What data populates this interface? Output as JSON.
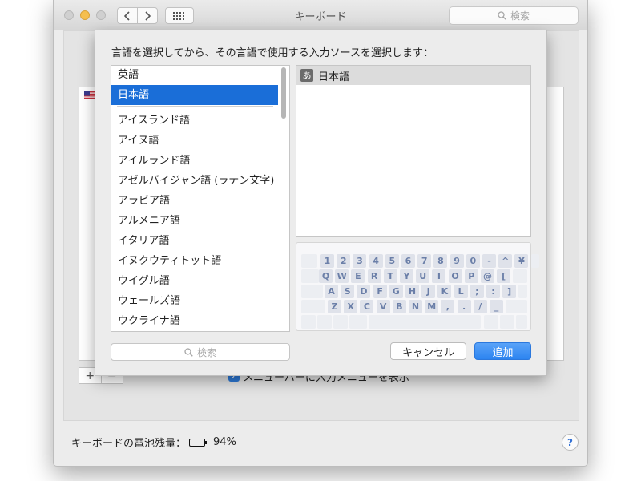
{
  "window": {
    "title": "キーボード",
    "search_placeholder": "検索"
  },
  "background": {
    "input_menu_checkbox_label": "メニューバーに入力メニューを表示",
    "battery_label": "キーボードの電池残量：",
    "battery_value": "94%",
    "battery_level": 0.94,
    "help_label": "?",
    "add_label": "+",
    "remove_label": "−"
  },
  "sheet": {
    "prompt": "言語を選択してから、その言語で使用する入力ソースを選択します：",
    "languages": [
      {
        "label": "英語",
        "selected": false
      },
      {
        "label": "日本語",
        "selected": true
      },
      {
        "label": "アイスランド語",
        "selected": false
      },
      {
        "label": "アイヌ語",
        "selected": false
      },
      {
        "label": "アイルランド語",
        "selected": false
      },
      {
        "label": "アゼルバイジャン語 (ラテン文字)",
        "selected": false
      },
      {
        "label": "アラビア語",
        "selected": false
      },
      {
        "label": "アルメニア語",
        "selected": false
      },
      {
        "label": "イタリア語",
        "selected": false
      },
      {
        "label": "イヌクウティトット語",
        "selected": false
      },
      {
        "label": "ウイグル語",
        "selected": false
      },
      {
        "label": "ウェールズ語",
        "selected": false
      },
      {
        "label": "ウクライナ語",
        "selected": false
      }
    ],
    "input_sources": [
      {
        "icon_glyph": "あ",
        "label": "日本語",
        "selected": true
      }
    ],
    "keyboard_rows": [
      [
        "1",
        "2",
        "3",
        "4",
        "5",
        "6",
        "7",
        "8",
        "9",
        "0",
        "-",
        "^",
        "¥"
      ],
      [
        "Q",
        "W",
        "E",
        "R",
        "T",
        "Y",
        "U",
        "I",
        "O",
        "P",
        "@",
        "["
      ],
      [
        "A",
        "S",
        "D",
        "F",
        "G",
        "H",
        "J",
        "K",
        "L",
        ";",
        ":",
        "]"
      ],
      [
        "Z",
        "X",
        "C",
        "V",
        "B",
        "N",
        "M",
        ",",
        ".",
        "/",
        "_"
      ]
    ],
    "search_placeholder": "検索",
    "cancel_label": "キャンセル",
    "add_label": "追加"
  },
  "colors": {
    "selection": "#1a6ed8",
    "default_button": "#2c84f0"
  }
}
